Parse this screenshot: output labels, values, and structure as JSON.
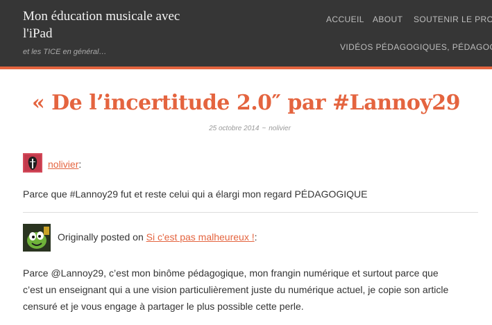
{
  "header": {
    "site_title": "Mon éducation musicale avec l'iPad",
    "site_description": "et les TICE en général…",
    "nav": {
      "accueil": "ACCUEIL",
      "about": "ABOUT",
      "soutenir": "SOUTENIR LE PROJ",
      "videos": "VIDÉOS PÉDAGOGIQUES, PÉDAGOGEE"
    }
  },
  "post": {
    "title": "« De l’incertitude 2.0″ par #Lannoy29",
    "date": "25 octobre 2014",
    "separator": "~",
    "author": "nolivier",
    "byline_author": "nolivier",
    "byline_suffix": ":",
    "paragraph1": "Parce que #Lannoy29 fut et reste celui qui a élargi mon regard PÉDAGOGIQUE",
    "reblog_prefix": "Originally posted on",
    "reblog_link": "Si c'est pas malheureux !",
    "reblog_suffix": ":",
    "paragraph2_line1": "Parce @Lannoy29, c’est mon binôme pédagogique, mon frangin numérique et surtout parce que",
    "paragraph2_line2": "c’est un enseignant qui a une vision particulièrement juste du numérique actuel, je copie son article",
    "paragraph2_line3": "censuré et je vous engage à partager le plus possible cette perle."
  },
  "colors": {
    "accent": "#e4643f",
    "header_bg": "#363636"
  }
}
